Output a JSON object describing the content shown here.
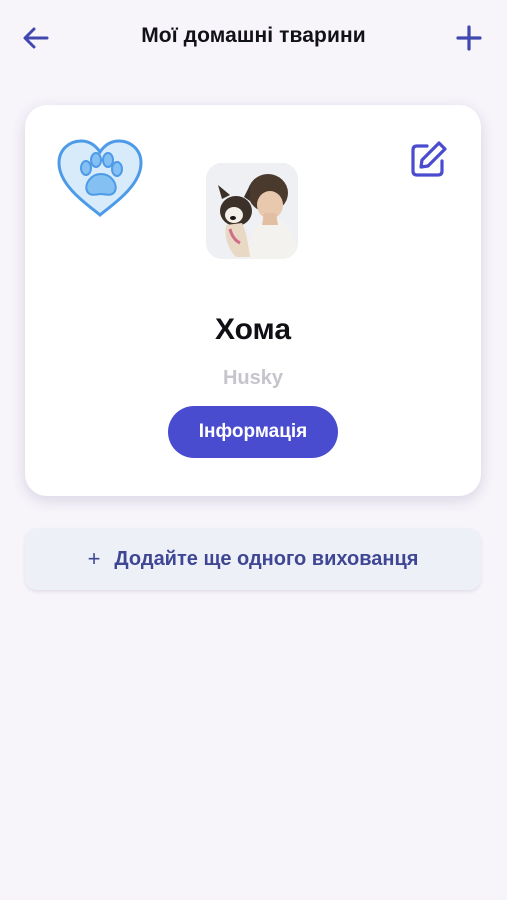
{
  "header": {
    "title": "Мої домашні тварини",
    "back_icon": "arrow-left-icon",
    "add_icon": "plus-icon"
  },
  "pet_card": {
    "name": "Хома",
    "breed": "Husky",
    "info_button": "Інформація",
    "badge_icon": "heart-paw-icon",
    "edit_icon": "edit-pencil-icon",
    "photo": "pet-photo"
  },
  "add_pet": {
    "plus": "+",
    "label": "Додайте ще одного вихованця"
  },
  "colors": {
    "accent": "#4a4cd0",
    "header_icons": "#4048b0",
    "heart_fill": "#d8ebfb",
    "heart_stroke": "#4d9be8",
    "breed_text": "#c5c5cb",
    "add_pet_bg": "#eef0f8",
    "background": "#f7f4fa"
  }
}
